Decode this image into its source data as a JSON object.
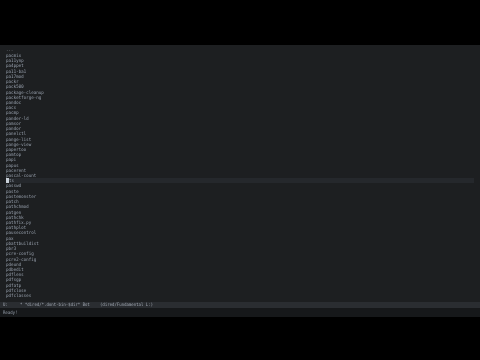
{
  "buffer": {
    "header": "...",
    "items_before_cursor": [
      "pacmix",
      "pa11ynp",
      "pa4ppet",
      "pa11-ba1",
      "pa17mod",
      "packr",
      "pack500",
      "package-cleanup",
      "packetforge-ng",
      "pandoc",
      "pacs",
      "pacmp",
      "pander-ld",
      "pamsor",
      "pandor",
      "panelctl",
      "pange-list",
      "pange-view",
      "papertoo",
      "pamtop",
      "papi",
      "papus",
      "pacerent",
      "pascal-count"
    ],
    "cursor_line": "ts",
    "items_after_cursor": [
      "passwd",
      "paste",
      "pastemonster",
      "patch",
      "pathchmod",
      "patgen",
      "pathchk",
      "pathfix.py",
      "pathplot",
      "pausecontrol",
      "pax",
      "pbattbuildist",
      "pbr3",
      "pcre-config",
      "pcre2-config",
      "pdeund",
      "pdbedit",
      "pdflens",
      "pdfsgp",
      "pdfatp",
      "pdfclose",
      "pdfclasses"
    ]
  },
  "modeline": {
    "left": "U:",
    "buffer": "* *dired/*.dont-bin-$dir*  Bot",
    "mode": "(dired/Fundamental L:)"
  },
  "echo_area": {
    "message": "Ready!"
  }
}
